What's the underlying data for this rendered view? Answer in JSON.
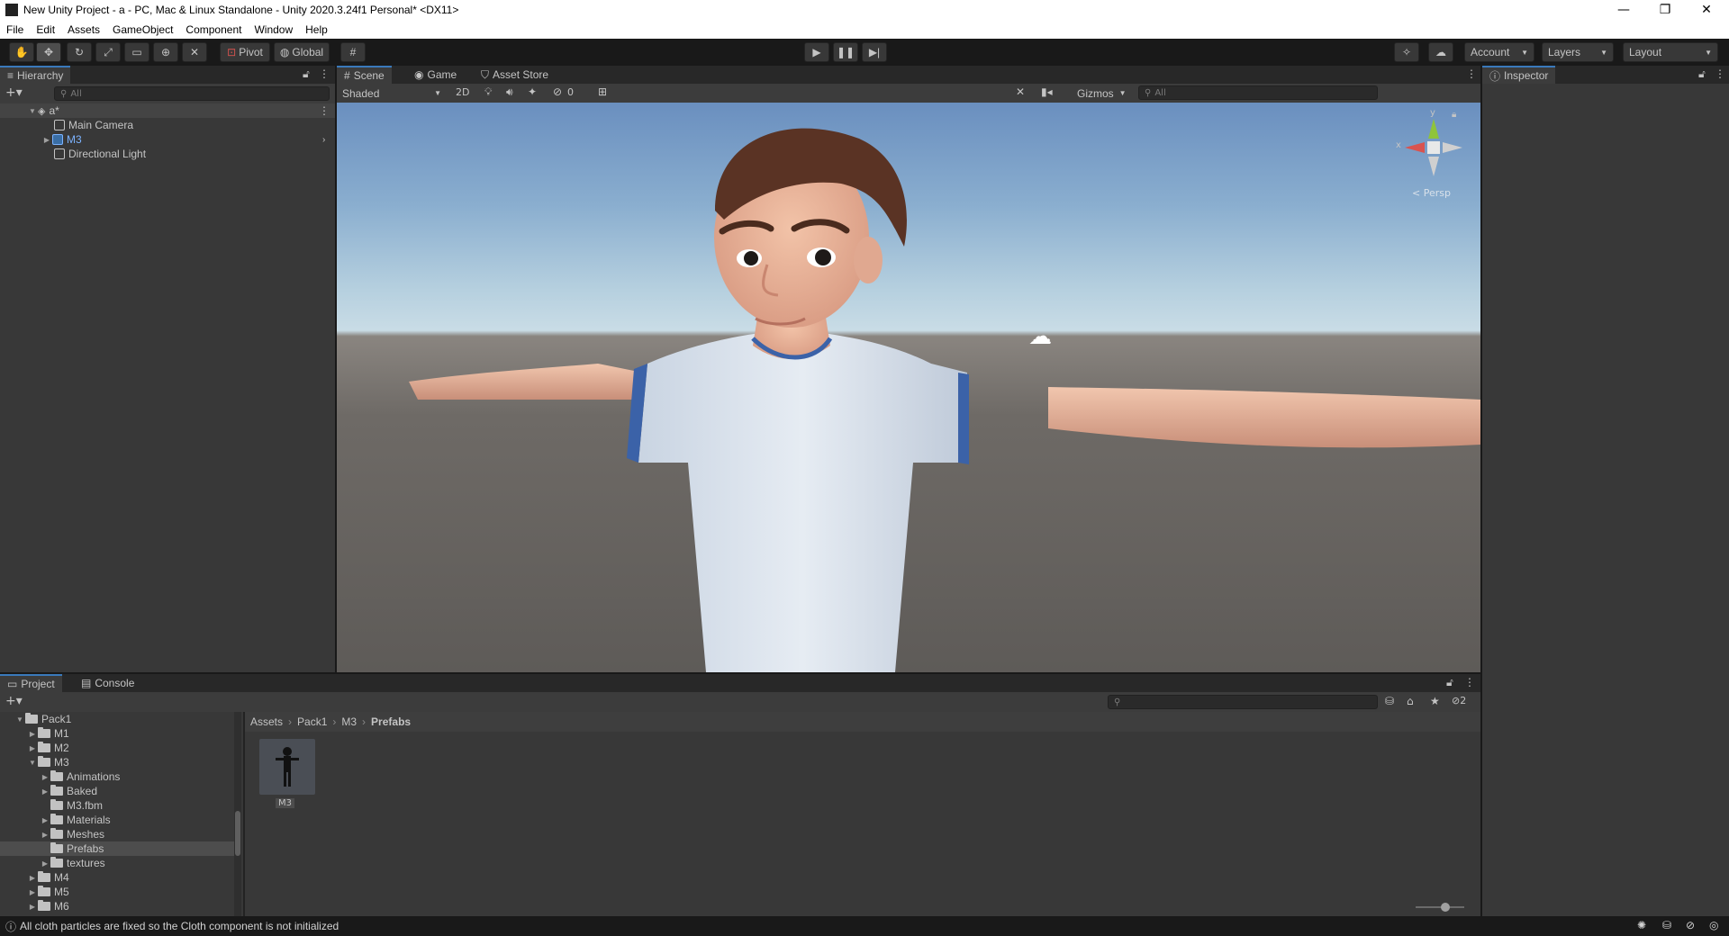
{
  "window": {
    "title": "New Unity Project - a - PC, Mac & Linux Standalone - Unity 2020.3.24f1 Personal* <DX11>",
    "minimize": "—",
    "maximize": "❐",
    "close": "✕"
  },
  "menu": [
    "File",
    "Edit",
    "Assets",
    "GameObject",
    "Component",
    "Window",
    "Help"
  ],
  "toolbar": {
    "pivot": "Pivot",
    "global": "Global",
    "account": "Account",
    "layers": "Layers",
    "layout": "Layout"
  },
  "hierarchy": {
    "tab": "Hierarchy",
    "search_placeholder": "All",
    "scene": "a*",
    "items": [
      "Main Camera",
      "M3",
      "Directional Light"
    ]
  },
  "scene_view": {
    "tabs": [
      "Scene",
      "Game",
      "Asset Store"
    ],
    "shading": "Shaded",
    "mode_2d": "2D",
    "hidden_count": "0",
    "gizmos": "Gizmos",
    "search_placeholder": "All",
    "persp": "Persp",
    "axis_x": "x",
    "axis_y": "y"
  },
  "inspector": {
    "tab": "Inspector"
  },
  "project": {
    "tabs": [
      "Project",
      "Console"
    ],
    "hidden_count": "2",
    "tree": [
      {
        "label": "Pack1",
        "depth": 0,
        "open": true
      },
      {
        "label": "M1",
        "depth": 1,
        "open": false
      },
      {
        "label": "M2",
        "depth": 1,
        "open": false
      },
      {
        "label": "M3",
        "depth": 1,
        "open": true
      },
      {
        "label": "Animations",
        "depth": 2,
        "open": false
      },
      {
        "label": "Baked",
        "depth": 2,
        "open": false
      },
      {
        "label": "M3.fbm",
        "depth": 2,
        "leaf": true
      },
      {
        "label": "Materials",
        "depth": 2,
        "open": false
      },
      {
        "label": "Meshes",
        "depth": 2,
        "open": false
      },
      {
        "label": "Prefabs",
        "depth": 2,
        "leaf": true,
        "selected": true
      },
      {
        "label": "textures",
        "depth": 2,
        "open": false
      },
      {
        "label": "M4",
        "depth": 1,
        "open": false
      },
      {
        "label": "M5",
        "depth": 1,
        "open": false
      },
      {
        "label": "M6",
        "depth": 1,
        "open": false
      }
    ],
    "breadcrumb": [
      "Assets",
      "Pack1",
      "M3",
      "Prefabs"
    ],
    "asset_label": "M3"
  },
  "status": {
    "message": "All cloth particles are fixed so the Cloth component is not initialized"
  },
  "colors": {
    "selection": "#2c5d87",
    "accent_tab": "#3a79bb",
    "prefab_text": "#7cb3ff"
  }
}
